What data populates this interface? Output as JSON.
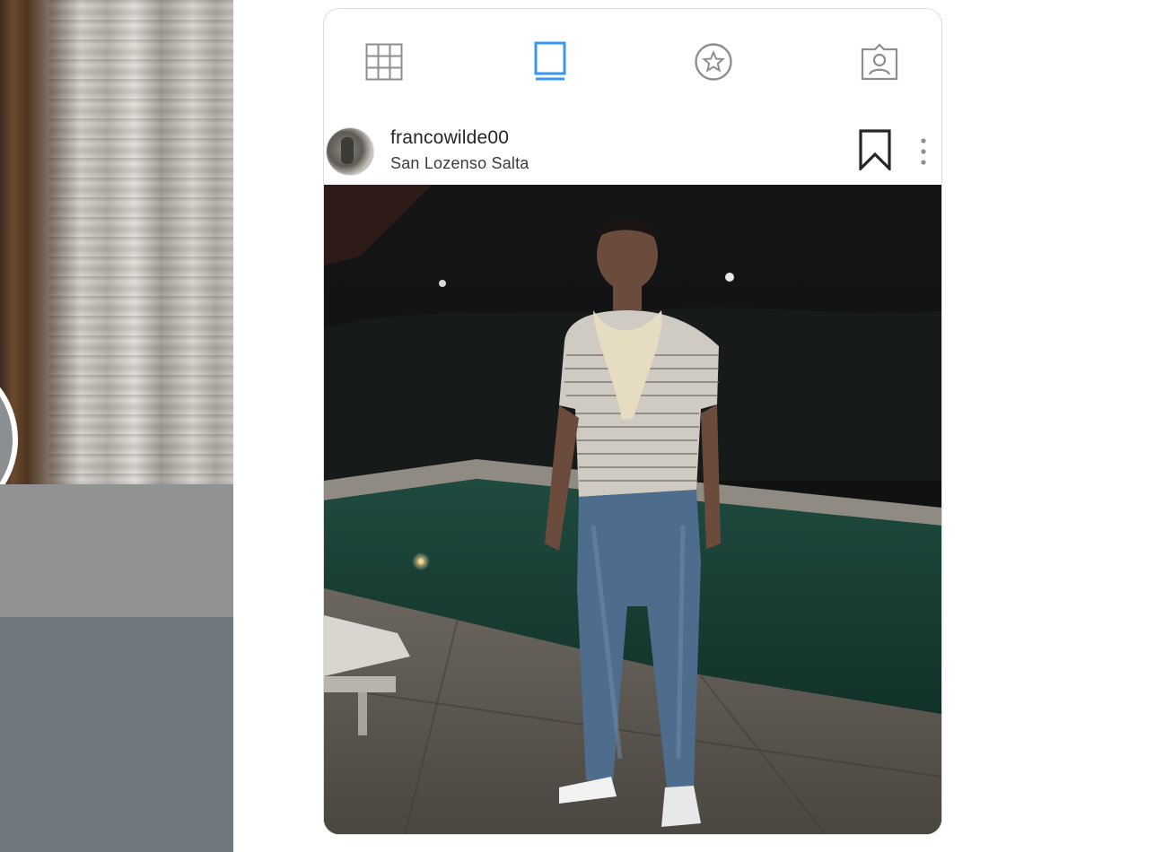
{
  "tabs": [
    {
      "name": "grid",
      "icon": "grid-icon",
      "active": false
    },
    {
      "name": "feed",
      "icon": "feed-icon",
      "active": true
    },
    {
      "name": "igtv",
      "icon": "igtv-icon",
      "active": false
    },
    {
      "name": "tagged",
      "icon": "tagged-icon",
      "active": false
    }
  ],
  "post": {
    "username": "francowilde00",
    "location": "San Lozenso Salta"
  },
  "colors": {
    "active_tab": "#3897f0",
    "inactive_tab": "#8e8e8e",
    "text_primary": "#262626",
    "card_border": "#dbdbdb"
  }
}
